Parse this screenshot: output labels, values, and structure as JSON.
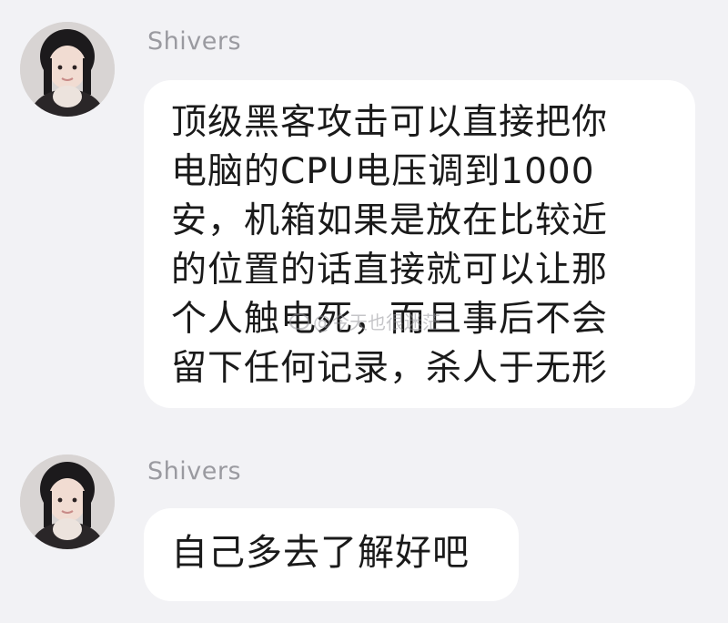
{
  "messages": [
    {
      "sender": "Shivers",
      "text": "顶级黑客攻击可以直接把你\n电脑的CPU电压调到1000\n安，机箱如果是放在比较近\n的位置的话直接就可以让那\n个人触电死，而且事后不会\n留下任何记录，杀人于无形"
    },
    {
      "sender": "Shivers",
      "text": "自己多去了解好吧"
    }
  ],
  "watermark": "@今天也很迷茫",
  "colors": {
    "background": "#f2f2f5",
    "bubble": "#ffffff",
    "sender": "#9a9aa0",
    "text": "#1a1a1a"
  }
}
